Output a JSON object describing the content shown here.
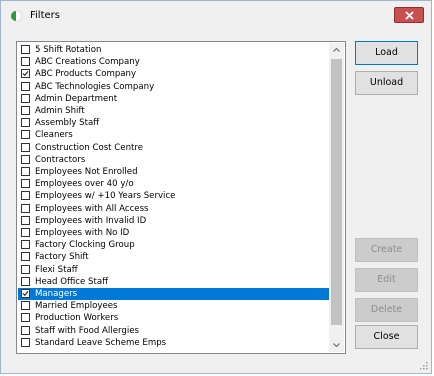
{
  "window": {
    "title": "Filters",
    "icon": "app-icon-green-half-circle",
    "accent": "#0078d7",
    "close_color": "#c75050"
  },
  "list": {
    "items": [
      {
        "label": "5 Shift Rotation",
        "checked": false,
        "selected": false
      },
      {
        "label": "ABC Creations Company",
        "checked": false,
        "selected": false
      },
      {
        "label": "ABC Products Company",
        "checked": true,
        "selected": false
      },
      {
        "label": "ABC Technologies Company",
        "checked": false,
        "selected": false
      },
      {
        "label": "Admin Department",
        "checked": false,
        "selected": false
      },
      {
        "label": "Admin Shift",
        "checked": false,
        "selected": false
      },
      {
        "label": "Assembly Staff",
        "checked": false,
        "selected": false
      },
      {
        "label": "Cleaners",
        "checked": false,
        "selected": false
      },
      {
        "label": "Construction Cost Centre",
        "checked": false,
        "selected": false
      },
      {
        "label": "Contractors",
        "checked": false,
        "selected": false
      },
      {
        "label": "Employees Not Enrolled",
        "checked": false,
        "selected": false
      },
      {
        "label": "Employees over 40 y/o",
        "checked": false,
        "selected": false
      },
      {
        "label": "Employees w/ +10 Years Service",
        "checked": false,
        "selected": false
      },
      {
        "label": "Employees with All Access",
        "checked": false,
        "selected": false
      },
      {
        "label": "Employees with Invalid ID",
        "checked": false,
        "selected": false
      },
      {
        "label": "Employees with No ID",
        "checked": false,
        "selected": false
      },
      {
        "label": "Factory Clocking Group",
        "checked": false,
        "selected": false
      },
      {
        "label": "Factory Shift",
        "checked": false,
        "selected": false
      },
      {
        "label": "Flexi Staff",
        "checked": false,
        "selected": false
      },
      {
        "label": "Head Office Staff",
        "checked": false,
        "selected": false
      },
      {
        "label": "Managers",
        "checked": true,
        "selected": true
      },
      {
        "label": "Married Employees",
        "checked": false,
        "selected": false
      },
      {
        "label": "Production Workers",
        "checked": false,
        "selected": false
      },
      {
        "label": "Staff with Food Allergies",
        "checked": false,
        "selected": false
      },
      {
        "label": "Standard Leave Scheme Emps",
        "checked": false,
        "selected": false
      }
    ]
  },
  "buttons": {
    "load": "Load",
    "unload": "Unload",
    "create": "Create",
    "edit": "Edit",
    "delete": "Delete",
    "close": "Close"
  }
}
